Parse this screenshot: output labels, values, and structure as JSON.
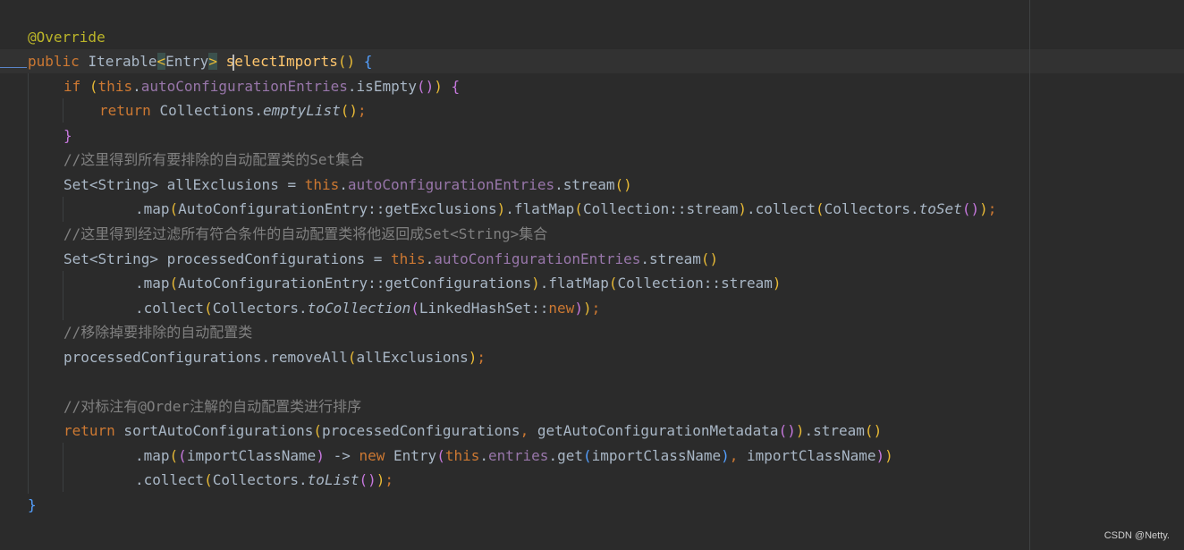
{
  "code": {
    "l1": {
      "anno": "@Override"
    },
    "l2": {
      "kw": "public",
      "type": "Iterable",
      "lt": "<",
      "entry": "Entry",
      "gt": ">",
      "method": "selectImports",
      "paren_open": "(",
      "paren_close": ")",
      "brace": "{"
    },
    "l3": {
      "kw": "if",
      "p_open": "(",
      "this": "this",
      "dot1": ".",
      "field": "autoConfigurationEntries",
      "dot2": ".",
      "call": "isEmpty",
      "p2_open": "(",
      "p2_close": ")",
      "p_close": ")",
      "brace": "{"
    },
    "l4": {
      "kw": "return",
      "cls": "Collections",
      "dot": ".",
      "call": "emptyList",
      "p_open": "(",
      "p_close": ")",
      "semi": ";"
    },
    "l5": {
      "brace": "}"
    },
    "l6": {
      "comment": "//这里得到所有要排除的自动配置类的Set集合"
    },
    "l7": {
      "decl": "Set<String> allExclusions = ",
      "this": "this",
      "dot": ".",
      "field": "autoConfigurationEntries",
      "call": ".stream",
      "p_open": "(",
      "p_close": ")"
    },
    "l8": {
      "call1": ".map",
      "p1_open": "(",
      "ref1": "AutoConfigurationEntry::getExclusions",
      "p1_close": ")",
      "call2": ".flatMap",
      "p2_open": "(",
      "ref2": "Collection::stream",
      "p2_close": ")",
      "call3": ".collect",
      "p3_open": "(",
      "cls": "Collectors.",
      "static": "toSet",
      "p4_open": "(",
      "p4_close": ")",
      "p3_close": ")",
      "semi": ";"
    },
    "l9": {
      "comment": "//这里得到经过滤所有符合条件的自动配置类将他返回成Set<String>集合"
    },
    "l10": {
      "decl": "Set<String> processedConfigurations = ",
      "this": "this",
      "dot": ".",
      "field": "autoConfigurationEntries",
      "call": ".stream",
      "p_open": "(",
      "p_close": ")"
    },
    "l11": {
      "call1": ".map",
      "p1_open": "(",
      "ref1": "AutoConfigurationEntry::getConfigurations",
      "p1_close": ")",
      "call2": ".flatMap",
      "p2_open": "(",
      "ref2": "Collection::stream",
      "p2_close": ")"
    },
    "l12": {
      "call": ".collect",
      "p1_open": "(",
      "cls": "Collectors.",
      "static": "toCollection",
      "p2_open": "(",
      "ref": "LinkedHashSet::",
      "new": "new",
      "p2_close": ")",
      "p1_close": ")",
      "semi": ";"
    },
    "l13": {
      "comment": "//移除掉要排除的自动配置类"
    },
    "l14": {
      "call": "processedConfigurations.removeAll",
      "p_open": "(",
      "arg": "allExclusions",
      "p_close": ")",
      "semi": ";"
    },
    "l16": {
      "comment": "//对标注有@Order注解的自动配置类进行排序"
    },
    "l17": {
      "kw": "return",
      "call": " sortAutoConfigurations",
      "p1_open": "(",
      "arg1": "processedConfigurations",
      "comma": ",",
      "arg2": " getAutoConfigurationMetadata",
      "p2_open": "(",
      "p2_close": ")",
      "p1_close": ")",
      "call2": ".stream",
      "p3_open": "(",
      "p3_close": ")"
    },
    "l18": {
      "call": ".map",
      "p1_open": "(",
      "p2_open": "(",
      "param": "importClassName",
      "p2_close": ")",
      "arrow": " -> ",
      "new": "new",
      "cls": " Entry",
      "p3_open": "(",
      "this": "this",
      "dot": ".",
      "field": "entries",
      "get": ".get",
      "p4_open": "(",
      "arg": "importClassName",
      "p4_close": ")",
      "comma": ",",
      "arg2": " importClassName",
      "p3_close": ")",
      "p1_close": ")"
    },
    "l19": {
      "call": ".collect",
      "p1_open": "(",
      "cls": "Collectors.",
      "static": "toList",
      "p2_open": "(",
      "p2_close": ")",
      "p1_close": ")",
      "semi": ";"
    },
    "l20": {
      "brace": "}"
    }
  },
  "watermark": "CSDN @Netty."
}
